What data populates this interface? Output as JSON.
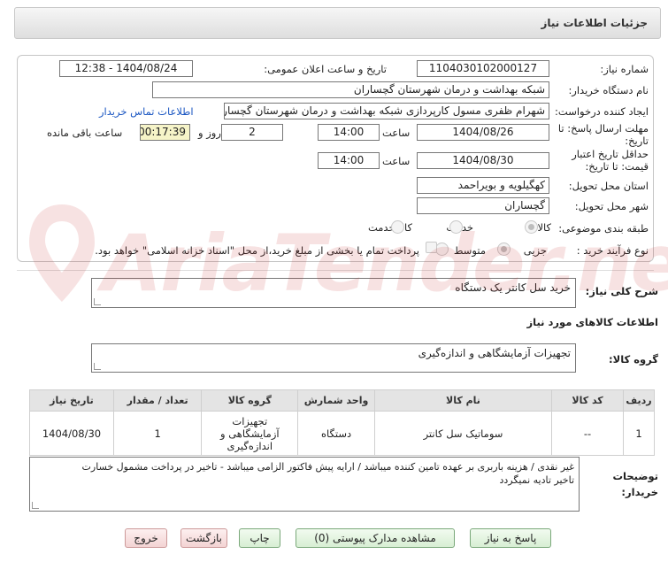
{
  "header": {
    "title": "جزئیات اطلاعات نیاز"
  },
  "form": {
    "need_number_label": "شماره نیاز:",
    "need_number": "1104030102000127",
    "announce_label": "تاریخ و ساعت اعلان عمومی:",
    "announce_value": "1404/08/24 - 12:38",
    "buyer_label": "نام دستگاه خریدار:",
    "buyer_value": "شبکه بهداشت و درمان شهرستان گچساران",
    "creator_label": "ایجاد کننده درخواست:",
    "creator_value": "شهرام ظفری مسول کارپردازی  شبکه بهداشت و درمان شهرستان گچساران",
    "contact_link": "اطلاعات تماس خریدار",
    "deadline_label": "مهلت ارسال پاسخ: تا تاریخ:",
    "deadline_date": "1404/08/26",
    "time_label": "ساعت",
    "deadline_time": "14:00",
    "days_count": "2",
    "days_label": "روز و",
    "remaining_time": "00:17:39",
    "remaining_label": "ساعت باقی مانده",
    "validity_label": "حداقل تاریخ اعتبار قیمت: تا تاریخ:",
    "validity_date": "1404/08/30",
    "validity_time": "14:00",
    "province_label": "استان محل تحویل:",
    "province_value": "کهگیلویه و بویراحمد",
    "city_label": "شهر محل تحویل:",
    "city_value": "گچساران",
    "category_label": "طبقه بندی موضوعی:",
    "category_options": [
      "کالا",
      "خدمت",
      "کالا/خدمت"
    ],
    "category_selected": "کالا",
    "process_label": "نوع فرآیند خرید :",
    "process_options": [
      "جزیی",
      "متوسط"
    ],
    "process_selected": "جزیی",
    "payment_note": "پرداخت تمام یا بخشی از مبلغ خرید،از محل \"اسناد خزانه اسلامی\" خواهد بود."
  },
  "description": {
    "label": "شرح کلی نیاز:",
    "value": "خرید سل کانتر یک دستگاه"
  },
  "goods_info_title": "اطلاعات کالاهای مورد نیاز",
  "goods_group": {
    "label": "گروه کالا:",
    "value": "تجهیزات آزمایشگاهی و اندازه‌گیری"
  },
  "table": {
    "headers": [
      "ردیف",
      "کد کالا",
      "نام کالا",
      "واحد شمارش",
      "گروه کالا",
      "تعداد / مقدار",
      "تاریخ نیاز"
    ],
    "rows": [
      {
        "row": "1",
        "code": "--",
        "name": "سوماتیک سل کانتر",
        "unit": "دستگاه",
        "group_line1": "تجهیزات",
        "group_line2": "آزمایشگاهی و",
        "group_line3": "اندازه‌گیری",
        "qty": "1",
        "date": "1404/08/30"
      }
    ]
  },
  "buyer_notes": {
    "label_line1": "توضیحات",
    "label_line2": "خریدار:",
    "line1": "غیر نقدی / هزینه باربری بر عهده تامین کننده میباشد / ارایه پیش فاکتور الزامی میباشد - تاخیر در پرداخت مشمول خسارت",
    "line2": "تاخیر تادیه نمیگردد"
  },
  "buttons": {
    "reply": "پاسخ به نیاز",
    "attachments": "مشاهده مدارک پیوستی (0)",
    "print": "چاپ",
    "back": "بازگشت",
    "exit": "خروج"
  },
  "watermark": {
    "text": "AriaTender.neT"
  },
  "colors": {
    "link": "#1a56c2",
    "remaining_bg": "#f6f4c8",
    "button_green": "#d7eed3",
    "button_red": "#f3d3d3"
  }
}
